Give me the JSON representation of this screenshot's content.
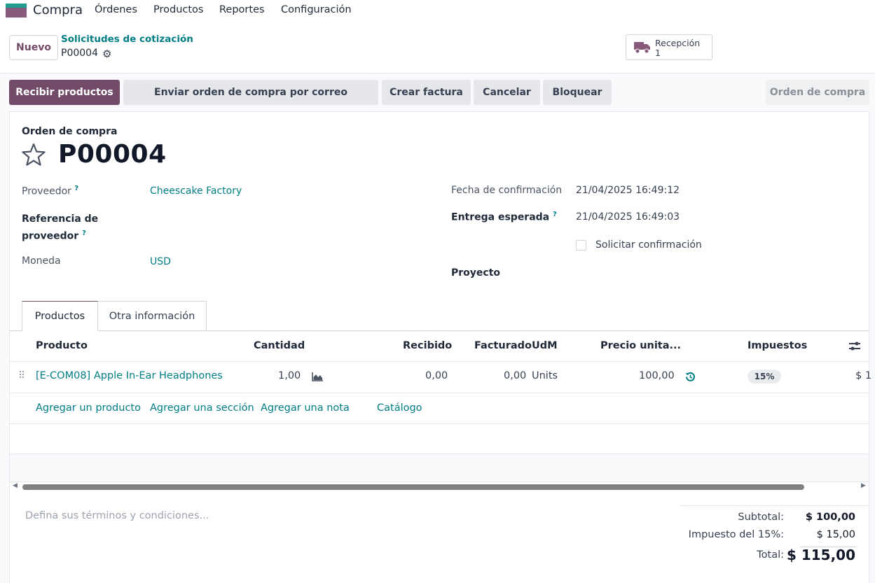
{
  "nav": {
    "app_name": "Compra",
    "menu": [
      "Órdenes",
      "Productos",
      "Reportes",
      "Configuración"
    ]
  },
  "control": {
    "new_label": "Nuevo",
    "breadcrumb_parent": "Solicitudes de cotización",
    "breadcrumb_current": "P00004",
    "smart_button": {
      "label": "Recepción",
      "count": "1"
    }
  },
  "actions": {
    "primary": "Recibir productos",
    "send_email": "Enviar orden de compra por correo electrónico",
    "create_invoice": "Crear factura",
    "cancel": "Cancelar",
    "lock": "Bloquear",
    "status": "Orden de compra"
  },
  "form": {
    "subtitle": "Orden de compra",
    "name": "P00004",
    "vendor_label": "Proveedor",
    "vendor_value": "Cheescake Factory",
    "vendor_ref_label_1": "Referencia de",
    "vendor_ref_label_2": "proveedor",
    "currency_label": "Moneda",
    "currency_value": "USD",
    "confirm_date_label": "Fecha de confirmación",
    "confirm_date_value": "21/04/2025 16:49:12",
    "expected_label": "Entrega esperada",
    "expected_value": "21/04/2025 16:49:03",
    "ask_confirm_label": "Solicitar confirmación",
    "project_label": "Proyecto",
    "help_mark": "?"
  },
  "tabs": [
    "Productos",
    "Otra información"
  ],
  "table": {
    "headers": {
      "product": "Producto",
      "qty": "Cantidad",
      "received": "Recibido",
      "billed": "Facturado",
      "uom": "UdM",
      "price": "Precio unita...",
      "taxes": "Impuestos"
    },
    "rows": [
      {
        "product": "[E-COM08] Apple In-Ear Headphones",
        "qty": "1,00",
        "received": "0,00",
        "billed": "0,00",
        "uom": "Units",
        "price": "100,00",
        "tax": "15%",
        "subtotal_partial": "$ 1"
      }
    ],
    "add_product": "Agregar un producto",
    "add_section": "Agregar una sección",
    "add_note": "Agregar una nota",
    "catalog": "Catálogo"
  },
  "footer": {
    "terms_placeholder": "Defina sus términos y condiciones...",
    "subtotal_label": "Subtotal:",
    "subtotal_value": "$ 100,00",
    "tax_label": "Impuesto del 15%:",
    "tax_value": "$ 15,00",
    "total_label": "Total:",
    "total_value": "$ 115,00"
  },
  "colors": {
    "brand": "#714b67",
    "link": "#017e84"
  }
}
